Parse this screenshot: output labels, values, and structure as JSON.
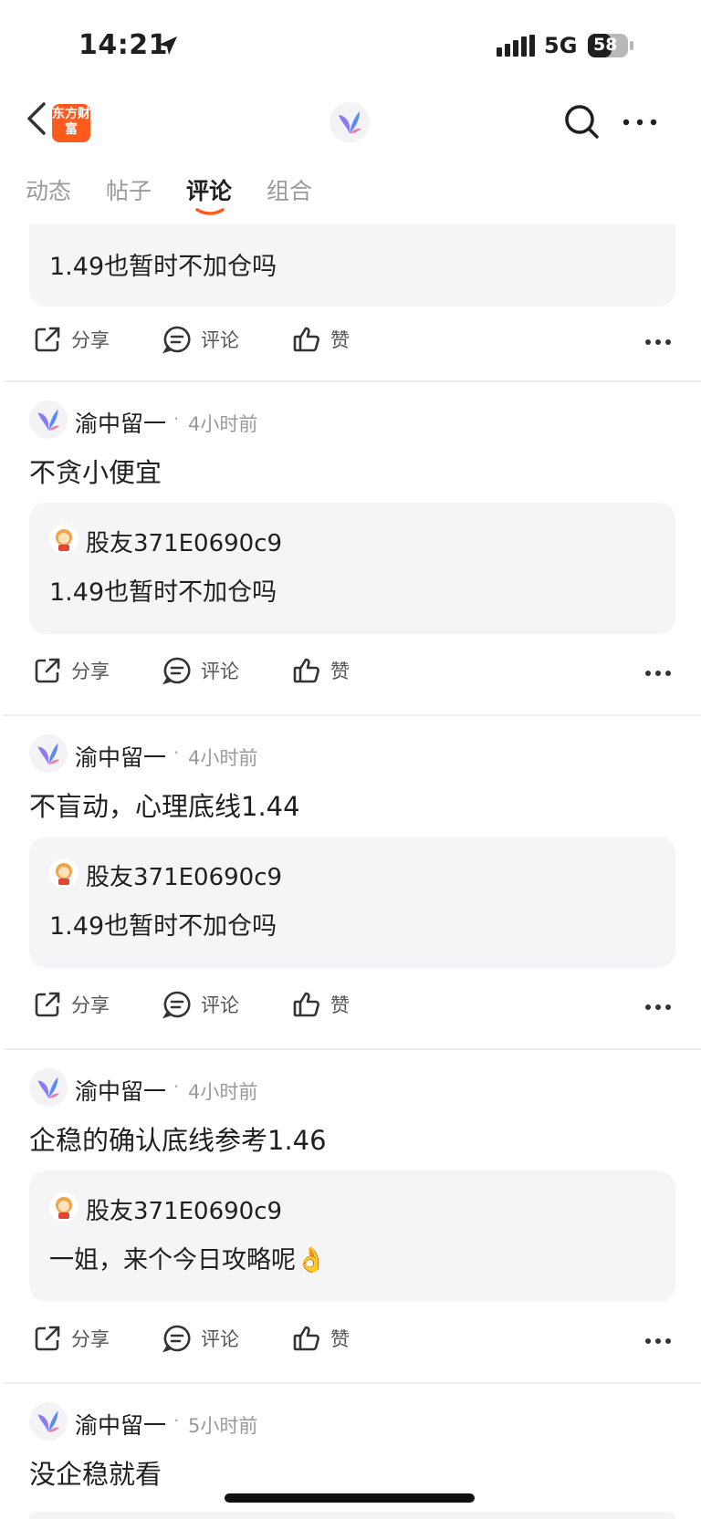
{
  "status_bar": {
    "time": "14:21",
    "network": "5G",
    "battery": "58"
  },
  "header": {
    "brand_logo_text": "东方财富"
  },
  "tabs": [
    {
      "label": "动态",
      "active": false
    },
    {
      "label": "帖子",
      "active": false
    },
    {
      "label": "评论",
      "active": true
    },
    {
      "label": "组合",
      "active": false
    }
  ],
  "actions": {
    "share": "分享",
    "comment": "评论",
    "like": "赞"
  },
  "top_fragment": {
    "quote_text": "1.49也暂时不加仓吗"
  },
  "posts": [
    {
      "author": "渝中留一",
      "time": "4小时前",
      "content": "不贪小便宜",
      "quote": {
        "author": "股友371E0690c9",
        "text": "1.49也暂时不加仓吗"
      }
    },
    {
      "author": "渝中留一",
      "time": "4小时前",
      "content": "不盲动，心理底线1.44",
      "quote": {
        "author": "股友371E0690c9",
        "text": "1.49也暂时不加仓吗"
      }
    },
    {
      "author": "渝中留一",
      "time": "4小时前",
      "content": "企稳的确认底线参考1.46",
      "quote": {
        "author": "股友371E0690c9",
        "text": "一姐，来个今日攻略呢👌"
      }
    },
    {
      "author": "渝中留一",
      "time": "5小时前",
      "content": "没企稳就看"
    }
  ],
  "colors": {
    "accent": "#ff5a1e",
    "quote_bg": "#f5f5f8"
  }
}
